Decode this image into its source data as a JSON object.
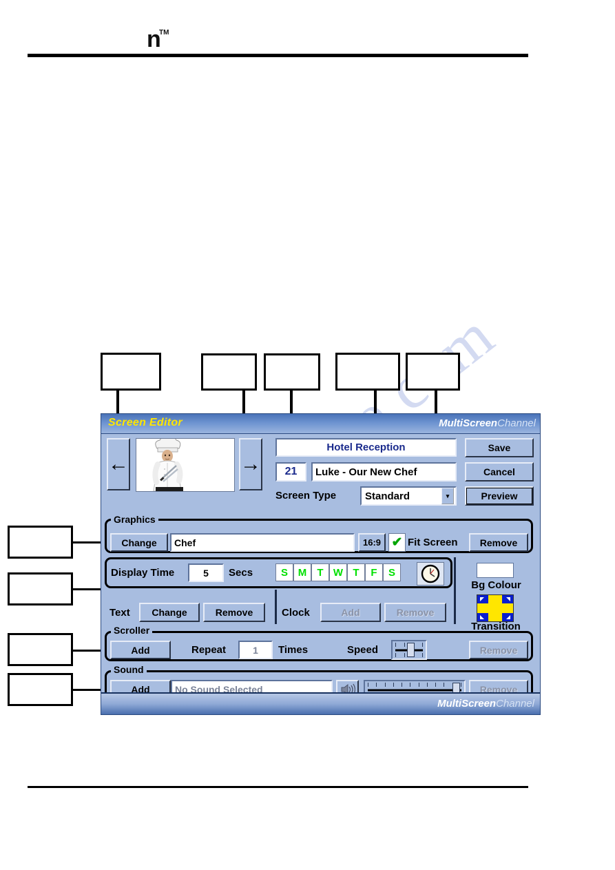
{
  "page": {
    "logo_letter": "n",
    "logo_tm": "TM",
    "watermark": "manualshive.com"
  },
  "window": {
    "title": "Screen Editor",
    "brand_bold": "MultiScreen",
    "brand_light": "Channel",
    "footer_brand_bold": "MultiScreen",
    "footer_brand_light": "Channel"
  },
  "preview": {
    "prev_arrow": "←",
    "next_arrow": "→",
    "image_alt": "chef-photo"
  },
  "header": {
    "channel_name": "Hotel Reception",
    "screen_number": "21",
    "screen_name": "Luke - Our New Chef",
    "screen_type_label": "Screen Type",
    "screen_type_value": "Standard",
    "screen_type_options": [
      "Standard"
    ],
    "save_label": "Save",
    "cancel_label": "Cancel",
    "preview_label": "Preview"
  },
  "graphics": {
    "group_label": "Graphics",
    "change_label": "Change",
    "filename": "Chef",
    "aspect_label": "16:9",
    "fit_screen_label": "Fit Screen",
    "fit_screen_checked": true,
    "check_glyph": "✔",
    "remove_label": "Remove"
  },
  "display": {
    "label": "Display Time",
    "value": "5",
    "units": "Secs",
    "days": [
      "S",
      "M",
      "T",
      "W",
      "T",
      "F",
      "S"
    ],
    "clock_icon": "clock-icon"
  },
  "text_row": {
    "text_label": "Text",
    "text_change_label": "Change",
    "text_remove_label": "Remove",
    "clock_label": "Clock",
    "clock_add_label": "Add",
    "clock_add_disabled": true,
    "clock_remove_label": "Remove",
    "clock_remove_disabled": true
  },
  "side": {
    "bg_colour_label": "Bg Colour",
    "bg_colour_value": "#ffffff",
    "transition_label": "Transition",
    "transition_icon_colors": {
      "cross": "#ffe600",
      "corner": "#0a1ecd"
    }
  },
  "scroller": {
    "group_label": "Scroller",
    "add_label": "Add",
    "repeat_label": "Repeat",
    "repeat_value": "1",
    "times_label": "Times",
    "speed_label": "Speed",
    "speed_percent": 52,
    "remove_label": "Remove",
    "remove_disabled": true
  },
  "sound": {
    "group_label": "Sound",
    "add_label": "Add",
    "filename": "No Sound Selected",
    "speaker_icon": "speaker-icon",
    "volume_percent": 90,
    "remove_label": "Remove",
    "remove_disabled": true
  },
  "callouts": [
    {
      "id": "callout-1",
      "label": ""
    },
    {
      "id": "callout-2",
      "label": ""
    },
    {
      "id": "callout-3",
      "label": ""
    },
    {
      "id": "callout-4",
      "label": ""
    },
    {
      "id": "callout-5",
      "label": ""
    },
    {
      "id": "callout-6",
      "label": ""
    },
    {
      "id": "callout-7",
      "label": ""
    },
    {
      "id": "callout-8",
      "label": ""
    },
    {
      "id": "callout-9",
      "label": ""
    }
  ]
}
